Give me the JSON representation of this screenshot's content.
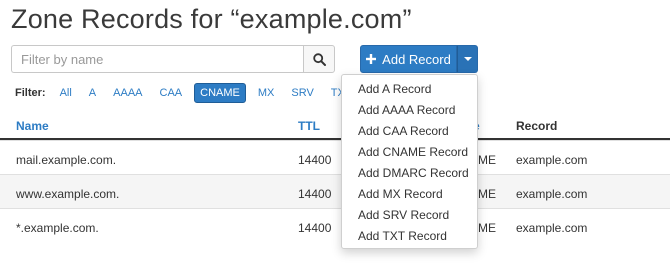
{
  "header": {
    "title": "Zone Records for “example.com”"
  },
  "search": {
    "placeholder": "Filter by name",
    "value": ""
  },
  "add_record": {
    "label": "Add Record"
  },
  "filter": {
    "label": "Filter:",
    "options": [
      "All",
      "A",
      "AAAA",
      "CAA",
      "CNAME",
      "MX",
      "SRV",
      "TXT"
    ],
    "active": "CNAME"
  },
  "table": {
    "columns": {
      "name": "Name",
      "ttl": "TTL",
      "type_partial": "e",
      "record": "Record"
    },
    "rows": [
      {
        "name": "mail.example.com.",
        "ttl": "14400",
        "type_partial": "ME",
        "record": "example.com"
      },
      {
        "name": "www.example.com.",
        "ttl": "14400",
        "type_partial": "ME",
        "record": "example.com"
      },
      {
        "name": "*.example.com.",
        "ttl": "14400",
        "type_partial": "ME",
        "record": "example.com"
      }
    ]
  },
  "dropdown": {
    "items": [
      "Add A Record",
      "Add AAAA Record",
      "Add CAA Record",
      "Add CNAME Record",
      "Add DMARC Record",
      "Add MX Record",
      "Add SRV Record",
      "Add TXT Record"
    ]
  },
  "colors": {
    "accent": "#2d7cc4",
    "accent_dark": "#1f5d97"
  },
  "icons": {
    "search": "search-icon",
    "add": "plus-icon",
    "toggle": "caret-down-icon"
  }
}
